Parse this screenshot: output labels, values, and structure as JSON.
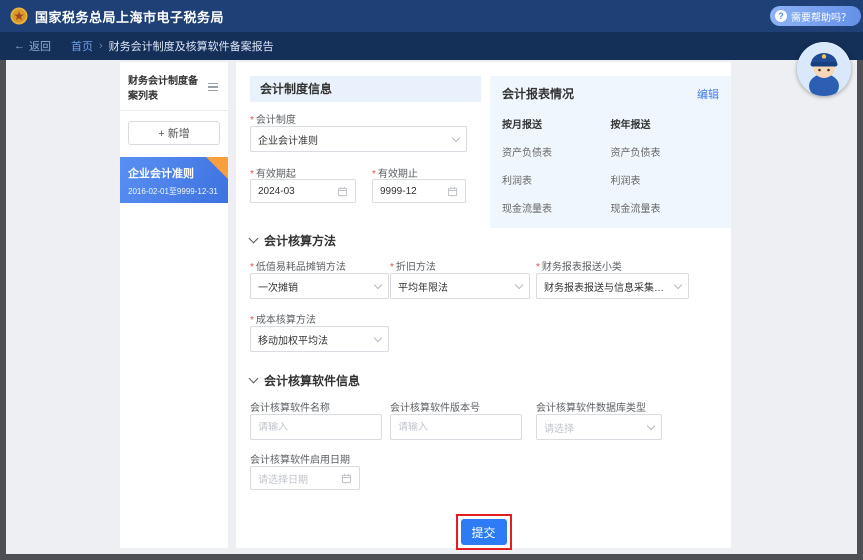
{
  "ui": {
    "required_mark": "*",
    "icons": {
      "back_arrow": "←",
      "breadcrumb_separator": "›",
      "help_mark": "?"
    },
    "colors": {
      "header_navy": "#1e4077",
      "subnav_navy": "#142f58",
      "primary_blue": "#2e7cf5",
      "panel_blue_bg": "#f0f6fd",
      "selected_card_blue": "#4a85ec",
      "ribbon_orange": "#f7a03c",
      "required_red": "#e34d4d",
      "annotation_red": "#e02020"
    }
  },
  "header": {
    "title": "国家税务总局上海市电子税务局",
    "help_button": "需要帮助吗？"
  },
  "nav": {
    "back_label": "返回",
    "breadcrumb": [
      "首页",
      "财务会计制度及核算软件备案报告"
    ]
  },
  "sidebar": {
    "title": "财务会计制度备案列表",
    "add_button_label": "+ 新增",
    "items": [
      {
        "name": "企业会计准则",
        "period": "2016-02-01至9999-12-31",
        "selected": true
      }
    ]
  },
  "accounting_system_info": {
    "title": "会计制度信息",
    "system_label": "会计制度",
    "system_value": "企业会计准则",
    "valid_from_label": "有效期起",
    "valid_from_value": "2024-03",
    "valid_to_label": "有效期止",
    "valid_to_value": "9999-12"
  },
  "report_status": {
    "title": "会计报表情况",
    "edit_label": "编辑",
    "monthly_header": "按月报送",
    "yearly_header": "按年报送",
    "monthly_reports": [
      "资产负债表",
      "利润表",
      "现金流量表"
    ],
    "yearly_reports": [
      "资产负债表",
      "利润表",
      "现金流量表"
    ]
  },
  "accounting_methods": {
    "title": "会计核算方法",
    "amortization_label": "低值易耗品摊销方法",
    "amortization_value": "一次摊销",
    "depreciation_label": "折旧方法",
    "depreciation_value": "平均年限法",
    "report_subtype_label": "财务报表报送小类",
    "report_subtype_value": "财务报表报送与信息采集（企业会...",
    "costing_label": "成本核算方法",
    "costing_value": "移动加权平均法"
  },
  "software_info": {
    "title": "会计核算软件信息",
    "name_label": "会计核算软件名称",
    "name_placeholder": "请输入",
    "version_label": "会计核算软件版本号",
    "version_placeholder": "请输入",
    "db_label": "会计核算软件数据库类型",
    "db_placeholder": "请选择",
    "date_label": "会计核算软件启用日期",
    "date_placeholder": "请选择日期"
  },
  "submit": {
    "label": "提交"
  }
}
